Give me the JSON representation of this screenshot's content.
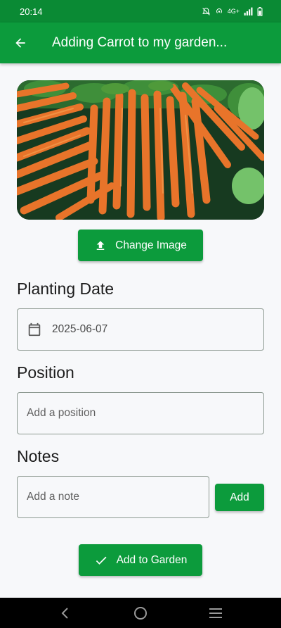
{
  "status_bar": {
    "time": "20:14",
    "network": "4G+"
  },
  "app_bar": {
    "title": "Adding Carrot to my garden..."
  },
  "hero": {
    "alt": "carrot-photo"
  },
  "change_image_label": "Change Image",
  "planting_date": {
    "title": "Planting Date",
    "value": "2025-06-07"
  },
  "position": {
    "title": "Position",
    "placeholder": "Add a position"
  },
  "notes": {
    "title": "Notes",
    "placeholder": "Add a note",
    "add_label": "Add"
  },
  "submit_label": "Add to Garden",
  "colors": {
    "primary": "#0c9b3c",
    "status_bar": "#0a8a34",
    "background": "#f7f8fa"
  },
  "icons": {
    "back": "arrow-left-icon",
    "upload": "upload-icon",
    "calendar": "calendar-icon",
    "check": "check-icon",
    "nav_back": "chevron-left-icon",
    "nav_home": "circle-home-icon",
    "nav_menu": "menu-icon"
  }
}
